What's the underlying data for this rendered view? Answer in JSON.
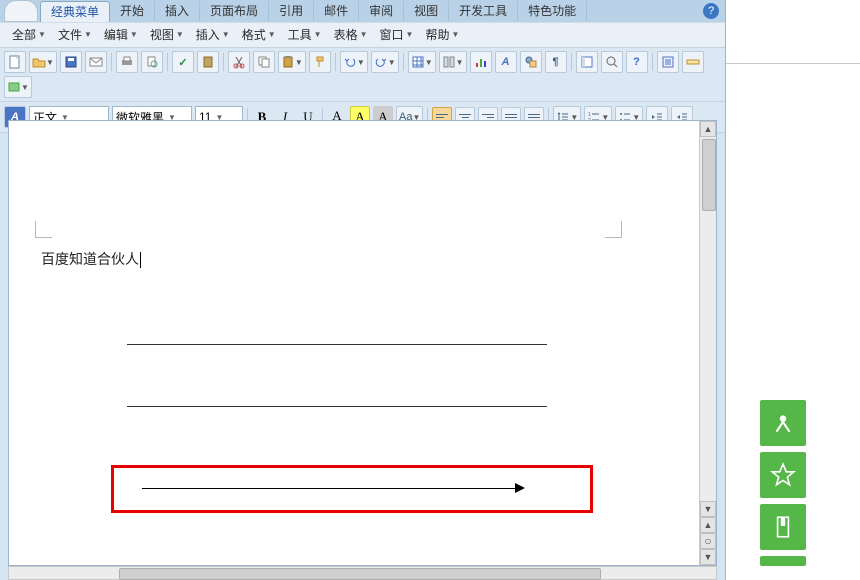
{
  "tabs": [
    "经典菜单",
    "开始",
    "插入",
    "页面布局",
    "引用",
    "邮件",
    "审阅",
    "视图",
    "开发工具",
    "特色功能"
  ],
  "menus": [
    "全部",
    "文件",
    "编辑",
    "视图",
    "插入",
    "格式",
    "工具",
    "表格",
    "窗口",
    "帮助"
  ],
  "combo": {
    "style": "正文",
    "font": "微软雅黑",
    "size": "11"
  },
  "fmt": {
    "bold": "B",
    "italic": "I",
    "underline": "U",
    "aa": "Aa"
  },
  "doc": {
    "text": "百度知道合伙人"
  },
  "glyph": {
    "help": "?",
    "dd": "▼",
    "up": "▲",
    "dn": "▼",
    "styleA": "A"
  }
}
